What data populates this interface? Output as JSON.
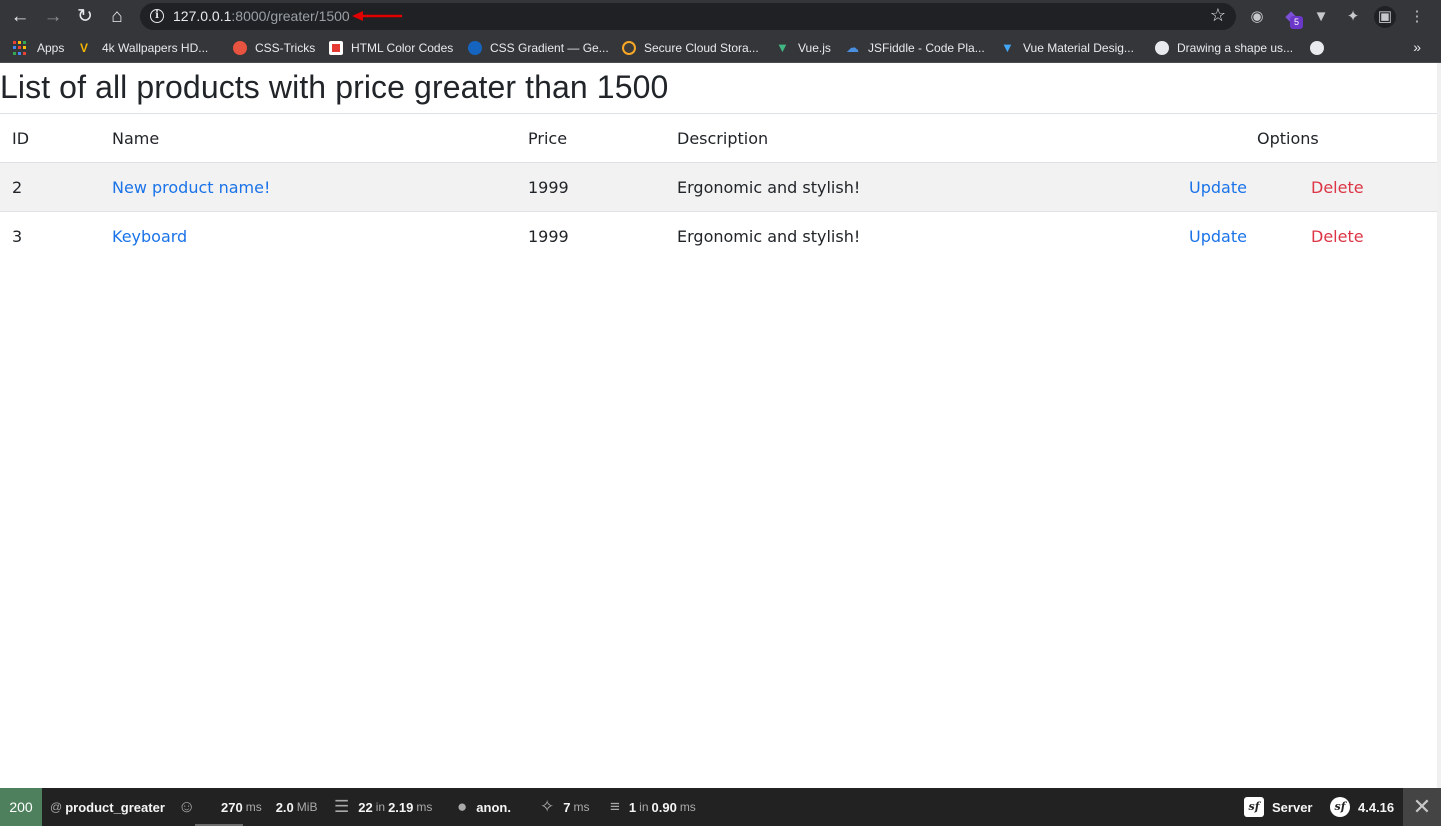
{
  "browser": {
    "url_host": "127.0.0.1",
    "url_rest": ":8000/greater/1500",
    "ext_badge": "5",
    "bookmarks": [
      {
        "label": "Apps",
        "icon": "apps-grid-icon"
      },
      {
        "label": "4k Wallpapers HD...",
        "icon": "wallpapers-icon",
        "color": "#f4b400"
      },
      {
        "label": "CSS-Tricks",
        "icon": "css-tricks-icon",
        "color": "#e8543f"
      },
      {
        "label": "HTML Color Codes",
        "icon": "html-color-codes-icon",
        "color": "#e53935"
      },
      {
        "label": "CSS Gradient — Ge...",
        "icon": "css-gradient-icon",
        "color": "#1565c0"
      },
      {
        "label": "Secure Cloud Stora...",
        "icon": "cloud-storage-icon",
        "color": "#f9a825"
      },
      {
        "label": "Vue.js",
        "icon": "vue-icon",
        "color": "#41b883"
      },
      {
        "label": "JSFiddle - Code Pla...",
        "icon": "jsfiddle-icon",
        "color": "#4a90e2"
      },
      {
        "label": "Vue Material Desig...",
        "icon": "vue-material-icon",
        "color": "#42a5f5"
      },
      {
        "label": "Drawing a shape us...",
        "icon": "globe-icon",
        "color": "#e8eaed"
      }
    ]
  },
  "page": {
    "title": "List of all products with price greater than 1500",
    "columns": [
      "ID",
      "Name",
      "Price",
      "Description",
      "Options"
    ],
    "rows": [
      {
        "id": "2",
        "name": "New product name!",
        "price": "1999",
        "description": "Ergonomic and stylish!",
        "update": "Update",
        "delete": "Delete"
      },
      {
        "id": "3",
        "name": "Keyboard",
        "price": "1999",
        "description": "Ergonomic and stylish!",
        "update": "Update",
        "delete": "Delete"
      }
    ]
  },
  "toolbar": {
    "status": "200",
    "route_prefix": "@",
    "route": "product_greater",
    "time_value": "270",
    "time_unit": "ms",
    "memory_value": "2.0",
    "memory_unit": "MiB",
    "twig_count": "22",
    "twig_in": "in",
    "twig_time": "2.19",
    "twig_unit": "ms",
    "user": "anon.",
    "events_value": "7",
    "events_unit": "ms",
    "db_count": "1",
    "db_in": "in",
    "db_time": "0.90",
    "db_unit": "ms",
    "server": "Server",
    "version": "4.4.16",
    "colors": {
      "status_bg": "#4f805d",
      "toolbar_bg": "#222222"
    }
  }
}
